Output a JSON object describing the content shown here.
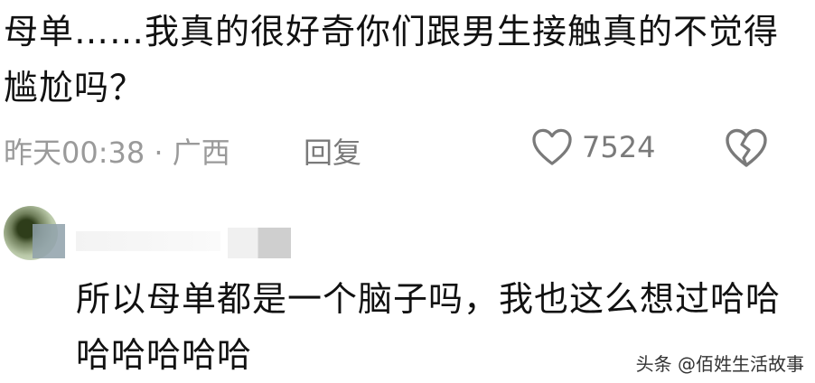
{
  "comment": {
    "text": "母单……我真的很好奇你们跟男生接触真的不觉得尴尬吗？",
    "timestamp": "昨天00:38 · 广西",
    "reply_label": "回复",
    "like_count": "7524",
    "like_icon": "heart-outline-icon",
    "dislike_icon": "broken-heart-icon"
  },
  "reply": {
    "text": "所以母单都是一个脑子吗，我也这么想过哈哈哈哈哈哈哈"
  },
  "watermark": {
    "text": "头条 @佰姓生活故事"
  },
  "colors": {
    "text": "#111111",
    "meta": "#9a9a9a",
    "icon": "#7a7a7a"
  }
}
